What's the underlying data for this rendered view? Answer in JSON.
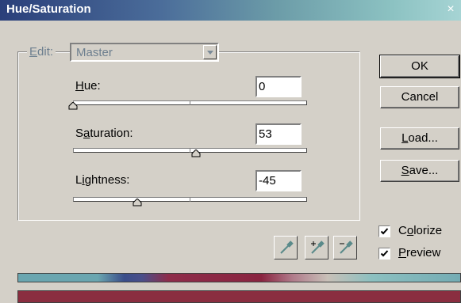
{
  "window": {
    "title": "Hue/Saturation",
    "close_glyph": "×"
  },
  "edit": {
    "label_prefix": "",
    "label_hotkey": "E",
    "label_rest": "dit:",
    "value": "Master"
  },
  "hue": {
    "label_hotkey": "H",
    "label_rest": "ue:",
    "value": "0",
    "slider_fraction": 0.0
  },
  "saturation": {
    "label_prefix": "S",
    "label_hotkey": "a",
    "label_rest": "turation:",
    "value": "53",
    "slider_fraction": 0.53
  },
  "lightness": {
    "label_prefix": "L",
    "label_hotkey": "i",
    "label_rest": "ghtness:",
    "value": "-45",
    "slider_fraction": -0.45
  },
  "buttons": {
    "ok": "OK",
    "cancel": "Cancel",
    "load_hotkey": "L",
    "load_rest": "oad...",
    "save_hotkey": "S",
    "save_rest": "ave..."
  },
  "eyedroppers": [
    "eyedropper-icon",
    "eyedropper-plus-icon",
    "eyedropper-minus-icon"
  ],
  "checkboxes": {
    "colorize": {
      "prefix": "C",
      "hotkey": "o",
      "rest": "lorize",
      "checked": true
    },
    "preview": {
      "hotkey": "P",
      "rest": "review",
      "checked": true
    }
  },
  "colors": {
    "title_start": "#2a3f7a",
    "title_end": "#a6d4d4",
    "result_bar": "#8a2e40"
  }
}
